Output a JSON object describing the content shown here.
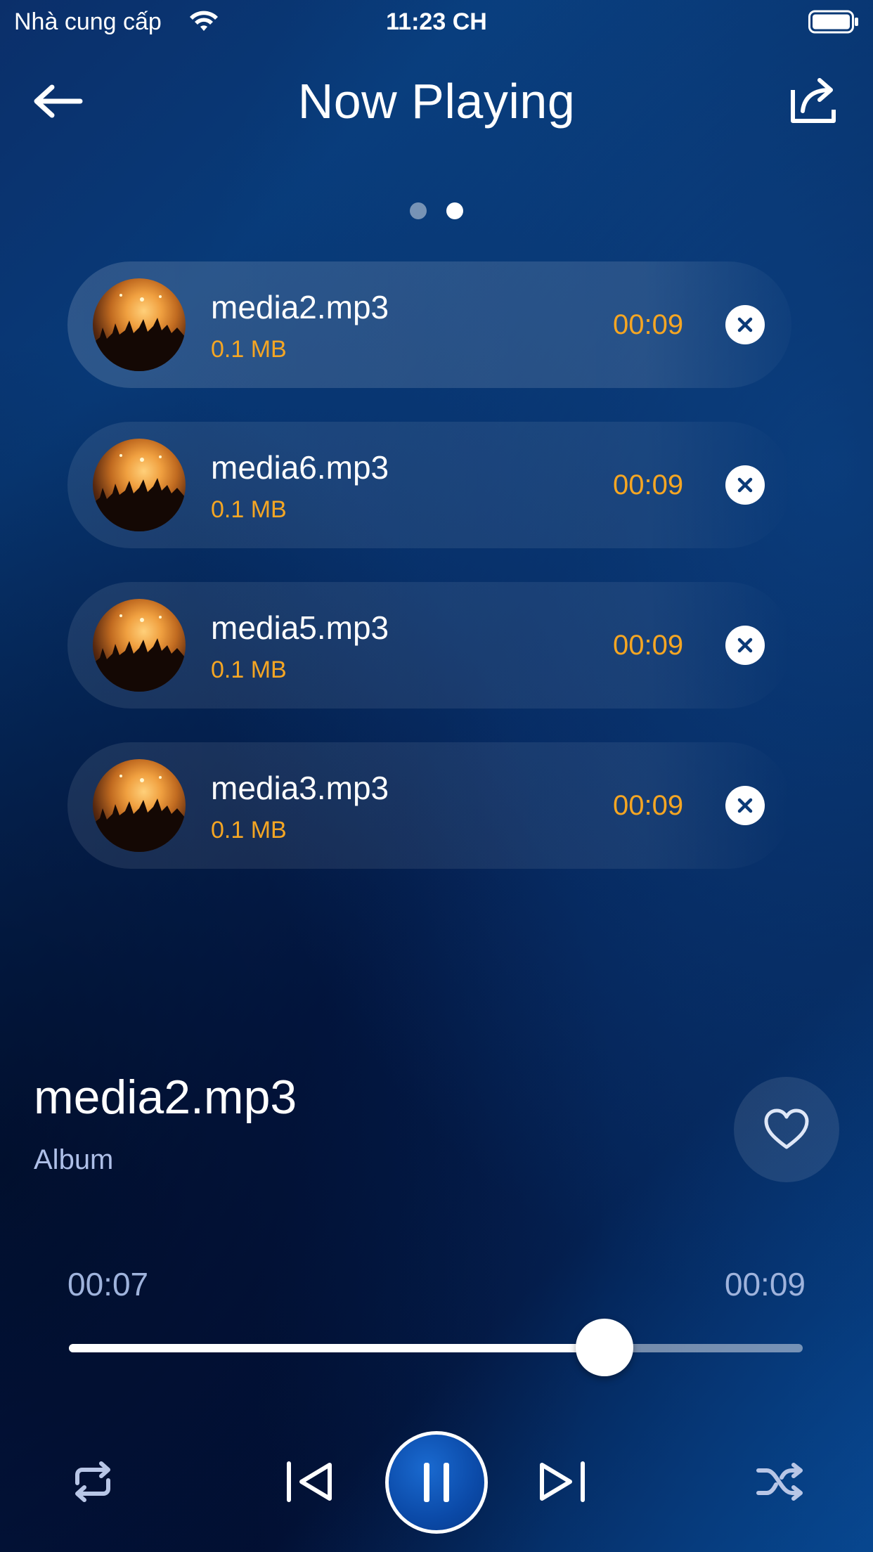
{
  "status_bar": {
    "carrier": "Nhà cung cấp",
    "time": "11:23 CH"
  },
  "header": {
    "title": "Now Playing",
    "back_icon": "arrow-left-icon",
    "share_icon": "share-icon"
  },
  "pager": {
    "count": 2,
    "active_index": 1
  },
  "playlist": [
    {
      "name": "media2.mp3",
      "size": "0.1 MB",
      "duration": "00:09",
      "active": true
    },
    {
      "name": "media6.mp3",
      "size": "0.1 MB",
      "duration": "00:09",
      "active": false
    },
    {
      "name": "media5.mp3",
      "size": "0.1 MB",
      "duration": "00:09",
      "active": false
    },
    {
      "name": "media3.mp3",
      "size": "0.1 MB",
      "duration": "00:09",
      "active": false
    }
  ],
  "now_playing": {
    "title": "media2.mp3",
    "album": "Album",
    "elapsed": "00:07",
    "total": "00:09",
    "progress_fraction": 0.73
  },
  "controls": {
    "repeat_icon": "repeat-icon",
    "prev_icon": "skip-previous-icon",
    "play_pause_icon": "pause-icon",
    "next_icon": "skip-next-icon",
    "shuffle_icon": "shuffle-icon",
    "favorite_icon": "heart-icon"
  },
  "colors": {
    "accent_orange": "#f5a623",
    "muted_text": "#9fb3dc",
    "play_button": "#0b4aa8"
  }
}
